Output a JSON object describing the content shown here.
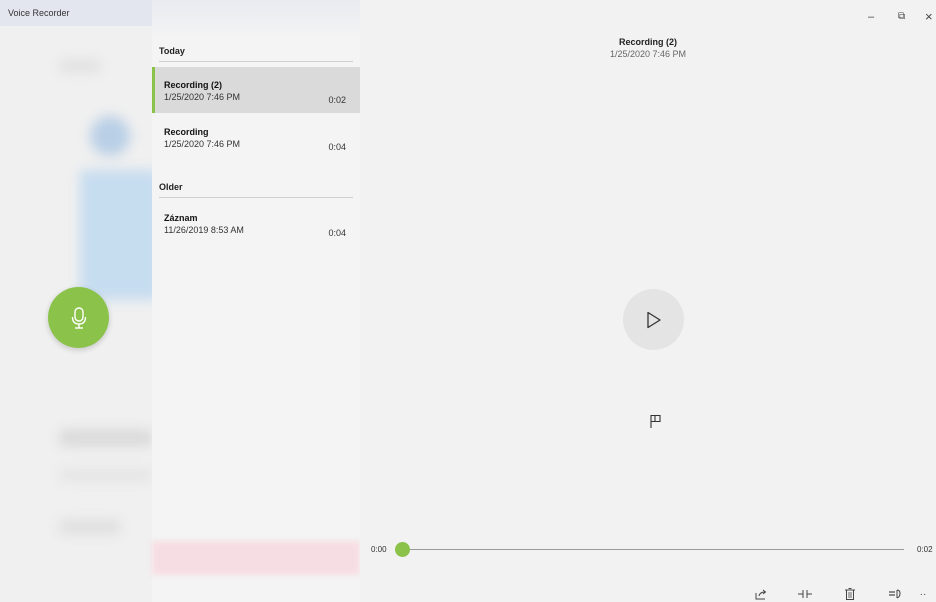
{
  "app": {
    "title": "Voice Recorder"
  },
  "window_controls": {
    "minimize": "–",
    "restore": "⧉",
    "close": "×"
  },
  "recordings": {
    "groups": [
      {
        "label": "Today",
        "items": [
          {
            "name": "Recording (2)",
            "date": "1/25/2020 7:46 PM",
            "duration": "0:02",
            "selected": true
          },
          {
            "name": "Recording",
            "date": "1/25/2020 7:46 PM",
            "duration": "0:04",
            "selected": false
          }
        ]
      },
      {
        "label": "Older",
        "items": [
          {
            "name": "Záznam",
            "date": "11/26/2019 8:53 AM",
            "duration": "0:04",
            "selected": false
          }
        ]
      }
    ]
  },
  "player": {
    "title": "Recording (2)",
    "date": "1/25/2020 7:46 PM",
    "current_time": "0:00",
    "total_time": "0:02",
    "progress": 0
  },
  "toolbar": {
    "icons": [
      "share-icon",
      "trim-icon",
      "delete-icon",
      "rename-icon",
      "more-icon"
    ],
    "more_label": "··"
  },
  "colors": {
    "accent": "#8bc34a",
    "selected_row": "#dadada",
    "background": "#f2f2f2"
  }
}
